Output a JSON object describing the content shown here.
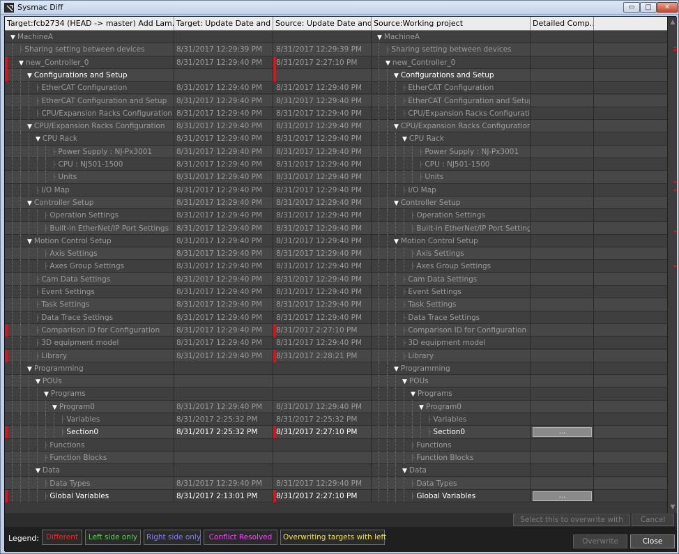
{
  "window": {
    "title": "Sysmac Diff",
    "min_glyph": "▭",
    "max_glyph": "□",
    "close_glyph": "✕"
  },
  "columns": [
    "Target:fcb2734  (HEAD -> master) Add Lam...",
    "Target: Update Date and ...",
    "Source: Update Date and ...",
    "Source:Working project",
    "Detailed Comp..."
  ],
  "rows": [
    {
      "d": 0,
      "t": "MachineA",
      "tu": "",
      "su": "",
      "b": false,
      "exp": true,
      "lm": false,
      "rm": false,
      "btn": false
    },
    {
      "d": 1,
      "t": "Sharing setting between devices",
      "tu": "8/31/2017 12:29:39 PM",
      "su": "8/31/2017 12:29:39 PM",
      "b": false,
      "exp": false,
      "lm": false,
      "rm": false,
      "btn": false
    },
    {
      "d": 1,
      "t": "new_Controller_0",
      "tu": "8/31/2017 12:29:40 PM",
      "su": "8/31/2017 2:27:10 PM",
      "b": false,
      "exp": true,
      "lm": true,
      "rm": true,
      "btn": false
    },
    {
      "d": 2,
      "t": "Configurations and Setup",
      "tu": "",
      "su": "",
      "b": true,
      "exp": true,
      "lm": true,
      "rm": true,
      "btn": false
    },
    {
      "d": 3,
      "t": "EtherCAT Configuration",
      "tu": "8/31/2017 12:29:40 PM",
      "su": "8/31/2017 12:29:40 PM",
      "b": false,
      "exp": false,
      "lm": false,
      "rm": false,
      "btn": false
    },
    {
      "d": 3,
      "t": "EtherCAT Configuration and Setup",
      "tu": "8/31/2017 12:29:40 PM",
      "su": "8/31/2017 12:29:40 PM",
      "b": false,
      "exp": false,
      "lm": false,
      "rm": false,
      "btn": false
    },
    {
      "d": 3,
      "t": "CPU/Expansion Racks Configuration",
      "tu": "8/31/2017 12:29:40 PM",
      "su": "8/31/2017 12:29:40 PM",
      "b": false,
      "exp": false,
      "lm": false,
      "rm": false,
      "btn": false
    },
    {
      "d": 2,
      "t": "CPU/Expansion Racks Configuration",
      "tu": "8/31/2017 12:29:40 PM",
      "su": "8/31/2017 12:29:40 PM",
      "b": false,
      "exp": true,
      "lm": false,
      "rm": false,
      "btn": false
    },
    {
      "d": 3,
      "t": "CPU Rack",
      "tu": "8/31/2017 12:29:40 PM",
      "su": "8/31/2017 12:29:40 PM",
      "b": false,
      "exp": true,
      "lm": false,
      "rm": false,
      "btn": false
    },
    {
      "d": 5,
      "t": "Power Supply : NJ-Px3001",
      "tu": "8/31/2017 12:29:40 PM",
      "su": "8/31/2017 12:29:40 PM",
      "b": false,
      "exp": false,
      "lm": false,
      "rm": false,
      "btn": false
    },
    {
      "d": 5,
      "t": "CPU : NJ501-1500",
      "tu": "8/31/2017 12:29:40 PM",
      "su": "8/31/2017 12:29:40 PM",
      "b": false,
      "exp": false,
      "lm": false,
      "rm": false,
      "btn": false
    },
    {
      "d": 5,
      "t": "Units",
      "tu": "8/31/2017 12:29:40 PM",
      "su": "8/31/2017 12:29:40 PM",
      "b": false,
      "exp": false,
      "lm": false,
      "rm": false,
      "btn": false
    },
    {
      "d": 3,
      "t": "I/O Map",
      "tu": "8/31/2017 12:29:40 PM",
      "su": "8/31/2017 12:29:40 PM",
      "b": false,
      "exp": false,
      "lm": false,
      "rm": false,
      "btn": false
    },
    {
      "d": 2,
      "t": "Controller Setup",
      "tu": "8/31/2017 12:29:40 PM",
      "su": "8/31/2017 12:29:40 PM",
      "b": false,
      "exp": true,
      "lm": false,
      "rm": false,
      "btn": false
    },
    {
      "d": 4,
      "t": "Operation Settings",
      "tu": "8/31/2017 12:29:40 PM",
      "su": "8/31/2017 12:29:40 PM",
      "b": false,
      "exp": false,
      "lm": false,
      "rm": false,
      "btn": false
    },
    {
      "d": 4,
      "t": "Built-in EtherNet/IP Port Settings",
      "tu": "8/31/2017 12:29:40 PM",
      "su": "8/31/2017 12:29:40 PM",
      "b": false,
      "exp": false,
      "lm": false,
      "rm": false,
      "btn": false
    },
    {
      "d": 2,
      "t": "Motion Control Setup",
      "tu": "8/31/2017 12:29:40 PM",
      "su": "8/31/2017 12:29:40 PM",
      "b": false,
      "exp": true,
      "lm": false,
      "rm": false,
      "btn": false
    },
    {
      "d": 4,
      "t": "Axis Settings",
      "tu": "8/31/2017 12:29:40 PM",
      "su": "8/31/2017 12:29:40 PM",
      "b": false,
      "exp": false,
      "lm": false,
      "rm": false,
      "btn": false
    },
    {
      "d": 4,
      "t": "Axes Group Settings",
      "tu": "8/31/2017 12:29:40 PM",
      "su": "8/31/2017 12:29:40 PM",
      "b": false,
      "exp": false,
      "lm": false,
      "rm": false,
      "btn": false
    },
    {
      "d": 3,
      "t": "Cam Data Settings",
      "tu": "8/31/2017 12:29:40 PM",
      "su": "8/31/2017 12:29:40 PM",
      "b": false,
      "exp": false,
      "lm": false,
      "rm": false,
      "btn": false
    },
    {
      "d": 3,
      "t": "Event Settings",
      "tu": "8/31/2017 12:29:40 PM",
      "su": "8/31/2017 12:29:40 PM",
      "b": false,
      "exp": false,
      "lm": false,
      "rm": false,
      "btn": false
    },
    {
      "d": 3,
      "t": "Task Settings",
      "tu": "8/31/2017 12:29:40 PM",
      "su": "8/31/2017 12:29:40 PM",
      "b": false,
      "exp": false,
      "lm": false,
      "rm": false,
      "btn": false
    },
    {
      "d": 3,
      "t": "Data Trace Settings",
      "tu": "8/31/2017 12:29:40 PM",
      "su": "8/31/2017 12:29:40 PM",
      "b": false,
      "exp": false,
      "lm": false,
      "rm": false,
      "btn": false
    },
    {
      "d": 3,
      "t": "Comparison ID for Configuration",
      "tu": "8/31/2017 12:29:40 PM",
      "su": "8/31/2017 2:27:10 PM",
      "b": false,
      "exp": false,
      "lm": true,
      "rm": true,
      "btn": false
    },
    {
      "d": 3,
      "t": "3D equipment model",
      "tu": "8/31/2017 12:29:40 PM",
      "su": "8/31/2017 12:29:40 PM",
      "b": false,
      "exp": false,
      "lm": false,
      "rm": false,
      "btn": false
    },
    {
      "d": 3,
      "t": "Library",
      "tu": "8/31/2017 12:29:40 PM",
      "su": "8/31/2017 2:28:21 PM",
      "b": false,
      "exp": false,
      "lm": true,
      "rm": true,
      "btn": false
    },
    {
      "d": 2,
      "t": "Programming",
      "tu": "",
      "su": "",
      "b": false,
      "exp": true,
      "lm": false,
      "rm": false,
      "btn": false
    },
    {
      "d": 3,
      "t": "POUs",
      "tu": "",
      "su": "",
      "b": false,
      "exp": true,
      "lm": false,
      "rm": false,
      "btn": false
    },
    {
      "d": 4,
      "t": "Programs",
      "tu": "",
      "su": "",
      "b": false,
      "exp": true,
      "lm": false,
      "rm": false,
      "btn": false
    },
    {
      "d": 5,
      "t": "Program0",
      "tu": "8/31/2017 12:29:40 PM",
      "su": "8/31/2017 12:29:40 PM",
      "b": false,
      "exp": true,
      "lm": false,
      "rm": false,
      "btn": false
    },
    {
      "d": 6,
      "t": "Variables",
      "tu": "8/31/2017 2:25:32 PM",
      "su": "8/31/2017 2:25:32 PM",
      "b": false,
      "exp": false,
      "lm": false,
      "rm": false,
      "btn": false
    },
    {
      "d": 6,
      "t": "Section0",
      "tu": "8/31/2017 2:25:32 PM",
      "su": "8/31/2017 2:27:10 PM",
      "b": true,
      "exp": false,
      "lm": true,
      "rm": true,
      "btn": true
    },
    {
      "d": 4,
      "t": "Functions",
      "tu": "",
      "su": "",
      "b": false,
      "exp": false,
      "lm": false,
      "rm": false,
      "btn": false
    },
    {
      "d": 4,
      "t": "Function Blocks",
      "tu": "",
      "su": "",
      "b": false,
      "exp": false,
      "lm": false,
      "rm": false,
      "btn": false
    },
    {
      "d": 3,
      "t": "Data",
      "tu": "",
      "su": "",
      "b": false,
      "exp": true,
      "lm": false,
      "rm": false,
      "btn": false
    },
    {
      "d": 4,
      "t": "Data Types",
      "tu": "8/31/2017 12:29:40 PM",
      "su": "8/31/2017 12:29:40 PM",
      "b": false,
      "exp": false,
      "lm": false,
      "rm": false,
      "btn": false
    },
    {
      "d": 4,
      "t": "Global Variables",
      "tu": "8/31/2017 2:13:01 PM",
      "su": "8/31/2017 2:27:10 PM",
      "b": true,
      "exp": false,
      "lm": true,
      "rm": true,
      "btn": true
    }
  ],
  "detail_button_label": "...",
  "buttons": {
    "overwrite_left": "Select this to overwrite with left",
    "cancel": "Cancel",
    "overwrite": "Overwrite",
    "close": "Close"
  },
  "legend": {
    "label": "Legend:",
    "items": [
      {
        "label": "Different",
        "color": "#ff2020"
      },
      {
        "label": "Left side only",
        "color": "#4ddc4d"
      },
      {
        "label": "Right side only",
        "color": "#7f7fff"
      },
      {
        "label": "Conflict Resolved",
        "color": "#ff3fff"
      },
      {
        "label": "Overwriting targets with left",
        "color": "#f0e040"
      }
    ]
  },
  "colors": {
    "diff_marker": "#d9141e"
  },
  "icons": {
    "expand": "▼",
    "branch": "├",
    "last_branch": "└"
  }
}
